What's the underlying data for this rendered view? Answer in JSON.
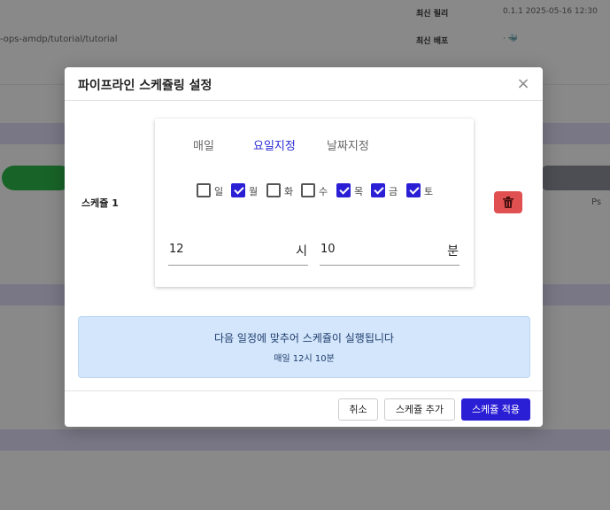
{
  "background": {
    "meta": [
      {
        "label": "최신 릴리",
        "value": "0.1.1 2025-05-16 12:30"
      },
      {
        "label": "최신 배포",
        "value": "· 🐳"
      }
    ],
    "path": "-ops-amdp/tutorial/tutorial",
    "row_label": "Ps"
  },
  "modal": {
    "title": "파이프라인 스케쥴링 설정",
    "close_icon": "×",
    "schedule_label": "스케쥴 1",
    "tabs": [
      "매일",
      "요일지정",
      "날짜지정"
    ],
    "active_tab": "요일지정",
    "days": [
      {
        "label": "일",
        "checked": false
      },
      {
        "label": "월",
        "checked": true
      },
      {
        "label": "화",
        "checked": false
      },
      {
        "label": "수",
        "checked": false
      },
      {
        "label": "목",
        "checked": true
      },
      {
        "label": "금",
        "checked": true
      },
      {
        "label": "토",
        "checked": true
      }
    ],
    "hour": {
      "value": "12",
      "unit": "시"
    },
    "minute": {
      "value": "10",
      "unit": "분"
    },
    "delete_icon": "trash-icon",
    "info": {
      "line1": "다음 일정에 맞추어 스케쥴이 실행됩니다",
      "line2": "매일 12시 10분"
    },
    "buttons": {
      "cancel": "취소",
      "add": "스케쥴 추가",
      "apply": "스케쥴 적용"
    }
  },
  "colors": {
    "accent": "#2b1fd6",
    "danger": "#e05050",
    "info_bg": "#d4e6fb"
  }
}
